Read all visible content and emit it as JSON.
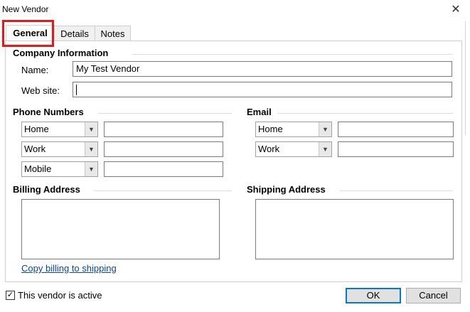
{
  "window": {
    "title": "New Vendor",
    "close_glyph": "✕"
  },
  "tabs": [
    {
      "label": "General",
      "active": true
    },
    {
      "label": "Details",
      "active": false
    },
    {
      "label": "Notes",
      "active": false
    }
  ],
  "company": {
    "group_title": "Company Information",
    "name_label": "Name:",
    "name_value": "My Test Vendor",
    "website_label": "Web site:",
    "website_value": ""
  },
  "phone": {
    "group_title": "Phone Numbers",
    "rows": [
      {
        "type": "Home",
        "value": ""
      },
      {
        "type": "Work",
        "value": ""
      },
      {
        "type": "Mobile",
        "value": ""
      }
    ]
  },
  "email": {
    "group_title": "Email",
    "rows": [
      {
        "type": "Home",
        "value": ""
      },
      {
        "type": "Work",
        "value": ""
      }
    ]
  },
  "billing": {
    "group_title": "Billing Address",
    "value": "",
    "copy_link": "Copy billing to shipping"
  },
  "shipping": {
    "group_title": "Shipping Address",
    "value": ""
  },
  "footer": {
    "active_checkbox_label": "This vendor is active",
    "active_checked": true,
    "check_glyph": "✓",
    "ok_label": "OK",
    "cancel_label": "Cancel"
  },
  "icons": {
    "dropdown": "chevron-down-icon",
    "close": "close-icon",
    "check": "checkmark-icon"
  },
  "colors": {
    "highlight": "#e31a1a",
    "link": "#0645ad",
    "default_button": "#0078d7"
  }
}
